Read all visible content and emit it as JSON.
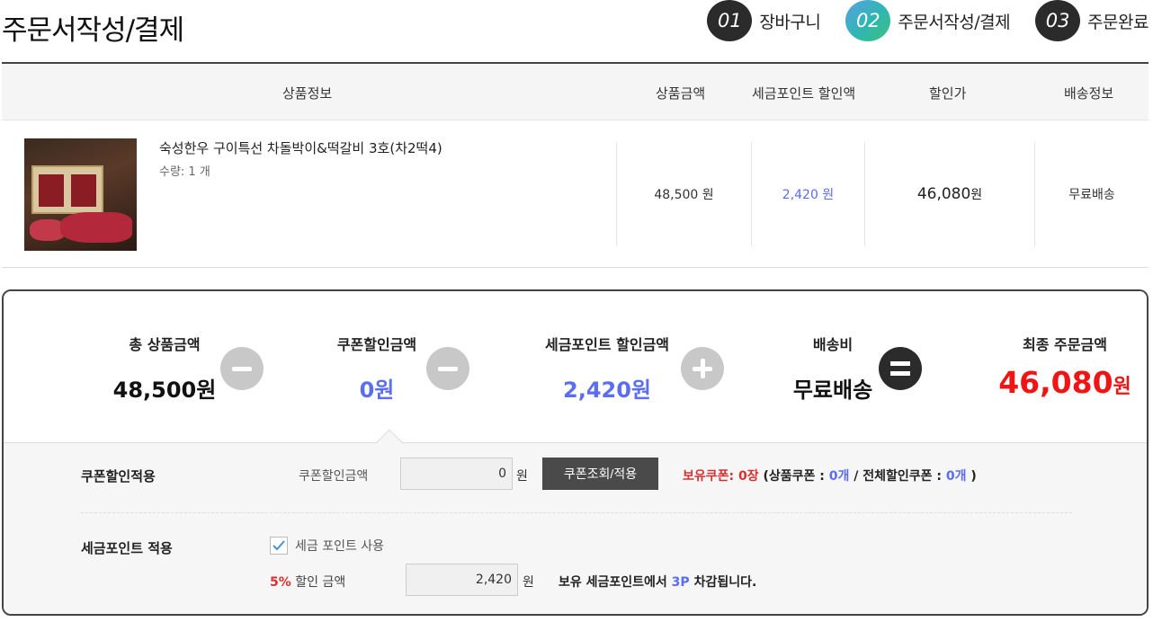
{
  "page": {
    "title": "주문서작성/결제"
  },
  "steps": [
    {
      "num": "01",
      "label": "장바구니"
    },
    {
      "num": "02",
      "label": "주문서작성/결제"
    },
    {
      "num": "03",
      "label": "주문완료"
    }
  ],
  "table": {
    "headers": {
      "info": "상품정보",
      "price": "상품금액",
      "point_discount": "세금포인트 할인액",
      "sale_price": "할인가",
      "shipping": "배송정보"
    },
    "item": {
      "name": "숙성한우 구이특선 차돌박이&떡갈비 3호(차2떡4)",
      "qty": "수량: 1 개",
      "price": "48,500 원",
      "point_discount": "2,420 원",
      "sale_price": "46,080",
      "sale_unit": "원",
      "shipping": "무료배송"
    }
  },
  "summary": {
    "total_label": "총 상품금액",
    "total_value": "48,500원",
    "coupon_label": "쿠폰할인금액",
    "coupon_value": "0원",
    "point_label": "세금포인트 할인금액",
    "point_value": "2,420원",
    "shipping_label": "배송비",
    "shipping_value": "무료배송",
    "final_label": "최종 주문금액",
    "final_value": "46,080",
    "final_unit": "원"
  },
  "coupon": {
    "section_label": "쿠폰할인적용",
    "field_label": "쿠폰할인금액",
    "value": "0",
    "unit": "원",
    "button": "쿠폰조회/적용",
    "owned_label": "보유쿠폰:",
    "owned_count": "0장",
    "detail_open": "(상품쿠폰 :",
    "product_count": "0개",
    "detail_sep": "/ 전체할인쿠폰 :",
    "all_count": "0개",
    "detail_close": ")"
  },
  "point": {
    "section_label": "세금포인트 적용",
    "checkbox_label": "세금 포인트 사용",
    "pct": "5%",
    "pct_label": "할인 금액",
    "value": "2,420",
    "unit": "원",
    "deduct_prefix": "보유 세금포인트에서",
    "deduct_amount": "3P",
    "deduct_suffix": "차감됩니다."
  },
  "colors": {
    "accent_blue": "#5b6df0",
    "final_red": "#f01414",
    "coupon_red": "#d93030"
  }
}
